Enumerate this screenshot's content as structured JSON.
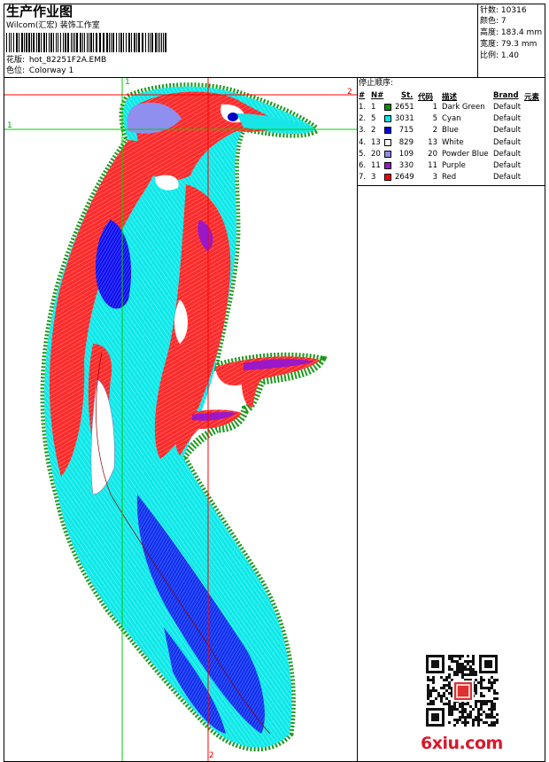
{
  "header": {
    "title": "生产作业图",
    "company": "Wilcom(汇宏) 装饰工作室",
    "pattern_label": "花版:",
    "pattern_value": "hot_82251F2A.EMB",
    "colorway_label": "色位:",
    "colorway_value": "Colorway 1"
  },
  "stats": {
    "stitches_label": "针数:",
    "stitches_value": "10316",
    "colors_label": "颜色:",
    "colors_value": "7",
    "height_label": "高度:",
    "height_value": "183.4 mm",
    "width_label": "宽度:",
    "width_value": "79.3 mm",
    "scale_label": "比例:",
    "scale_value": "1.40"
  },
  "stop_sequence": {
    "title": "停止顺序:",
    "columns": [
      "#",
      "N#",
      "St.",
      "代码",
      "描述",
      "Brand",
      "元素"
    ],
    "rows": [
      {
        "idx": "1.",
        "n": "1",
        "st": "2651",
        "code": "1",
        "desc": "Dark Green",
        "brand": "Default",
        "color": "#0c8a0c"
      },
      {
        "idx": "2.",
        "n": "5",
        "st": "3031",
        "code": "5",
        "desc": "Cyan",
        "brand": "Default",
        "color": "#00e6e6"
      },
      {
        "idx": "3.",
        "n": "2",
        "st": "715",
        "code": "2",
        "desc": "Blue",
        "brand": "Default",
        "color": "#0000ee"
      },
      {
        "idx": "4.",
        "n": "13",
        "st": "829",
        "code": "13",
        "desc": "White",
        "brand": "Default",
        "color": "#ffffff"
      },
      {
        "idx": "5.",
        "n": "20",
        "st": "109",
        "code": "20",
        "desc": "Powder Blue",
        "brand": "Default",
        "color": "#8c8cf0"
      },
      {
        "idx": "6.",
        "n": "11",
        "st": "330",
        "code": "11",
        "desc": "Purple",
        "brand": "Default",
        "color": "#9a18c8"
      },
      {
        "idx": "7.",
        "n": "3",
        "st": "2649",
        "code": "3",
        "desc": "Red",
        "brand": "Default",
        "color": "#ff0000"
      }
    ]
  },
  "design": {
    "markers": {
      "vert_top": "1",
      "vert_bottom": "2",
      "horiz_left": "1",
      "horiz_right": "2"
    },
    "guide_color_green": "#00cc00",
    "guide_color_red": "#ff0000"
  },
  "watermark": {
    "text": "6xiu.com"
  }
}
